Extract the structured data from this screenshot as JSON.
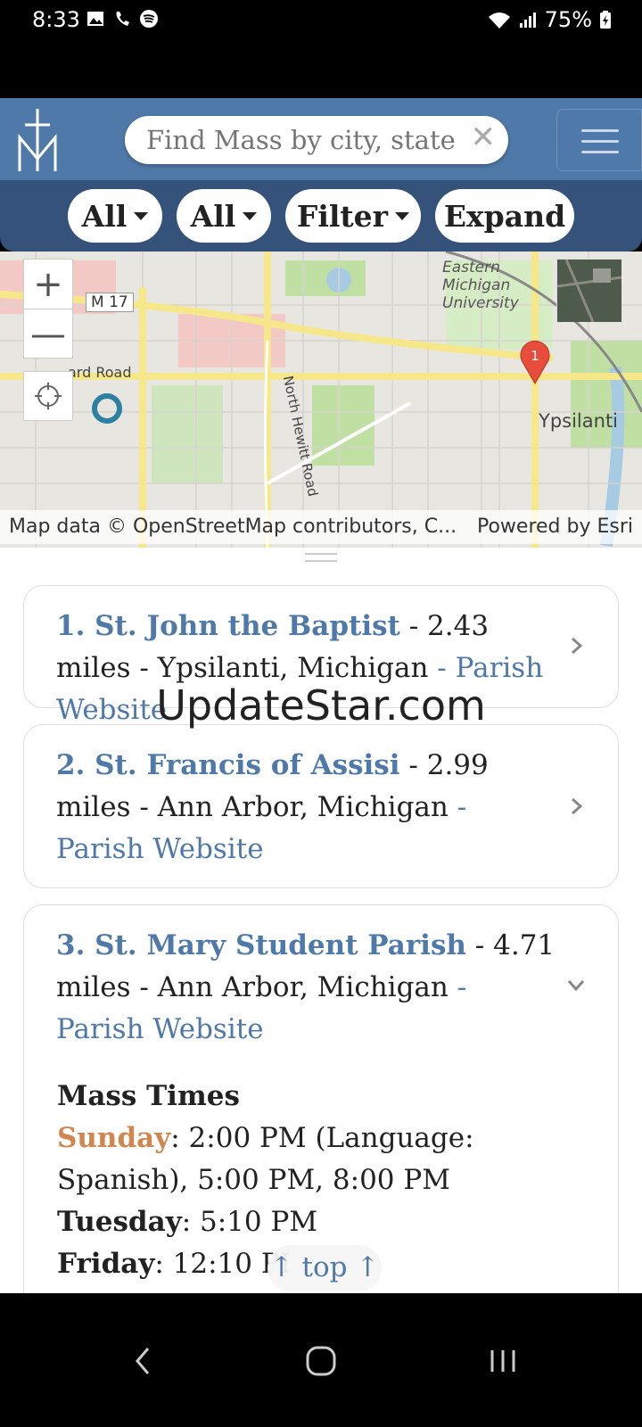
{
  "status_bar": {
    "time": "8:33",
    "battery": "75%",
    "icons": [
      "gallery-icon",
      "wifi-call-icon",
      "spotify-icon",
      "wifi-icon",
      "signal-icon",
      "battery-icon"
    ]
  },
  "header": {
    "logo": "mass-times-logo",
    "search": {
      "placeholder": "Find Mass by city, state o...",
      "clear_glyph": "✕"
    },
    "menu_icon": "hamburger-icon"
  },
  "filters": [
    {
      "label": "All",
      "has_caret": true
    },
    {
      "label": "All",
      "has_caret": true
    },
    {
      "label": "Filter",
      "has_caret": true
    },
    {
      "label": "Expand",
      "has_caret": false
    }
  ],
  "map": {
    "zoom_in": "+",
    "zoom_out": "—",
    "labels": {
      "university": "Eastern Michigan University",
      "university_l1": "Eastern",
      "university_l2": "Michigan",
      "university_l3": "University",
      "route": "M 17",
      "road": "ard Road",
      "street": "North Hewitt Road",
      "city": "Ypsilanti"
    },
    "marker_number": "1",
    "attribution_left": "Map data © OpenStreetMap contributors, C...",
    "attribution_right": "Powered by Esri",
    "colors": {
      "water": "#a6cbe3",
      "park": "#bfe0a2",
      "road_major": "#f6e88a",
      "residential": "#f2c9c5"
    }
  },
  "results": [
    {
      "name": "1. St. John the Baptist",
      "distance": " - 2.43 miles - ",
      "location": "Ypsilanti, Michigan",
      "link": " - Parish Website",
      "expanded": false
    },
    {
      "name": "2. St. Francis of Assisi",
      "distance": " - 2.99 miles - ",
      "location": "Ann Arbor, Michigan",
      "link": " - Parish Website",
      "expanded": false
    },
    {
      "name": "3. St. Mary Student Parish",
      "distance": " - 4.71 miles - ",
      "location": "Ann Arbor, Michigan",
      "link": " - Parish Website",
      "expanded": true
    }
  ],
  "mass_times": {
    "heading": "Mass Times",
    "sunday_label": "Sunday",
    "sunday_times": ": 2:00 PM (Language: Spanish), 5:00 PM, 8:00 PM",
    "tuesday_label": "Tuesday",
    "tuesday_times": ": 5:10 PM",
    "friday_label": "Friday",
    "friday_times": ": 12:10 PI"
  },
  "top_button": "↑ top ↑",
  "watermark": "UpdateStar.com",
  "nav": {
    "back": "back-icon",
    "home": "home-icon",
    "recents": "recents-icon"
  },
  "colors": {
    "header": "#4f79a8",
    "filterbar": "#34527a",
    "link": "#4f79a8",
    "sunday": "#d0864e"
  }
}
